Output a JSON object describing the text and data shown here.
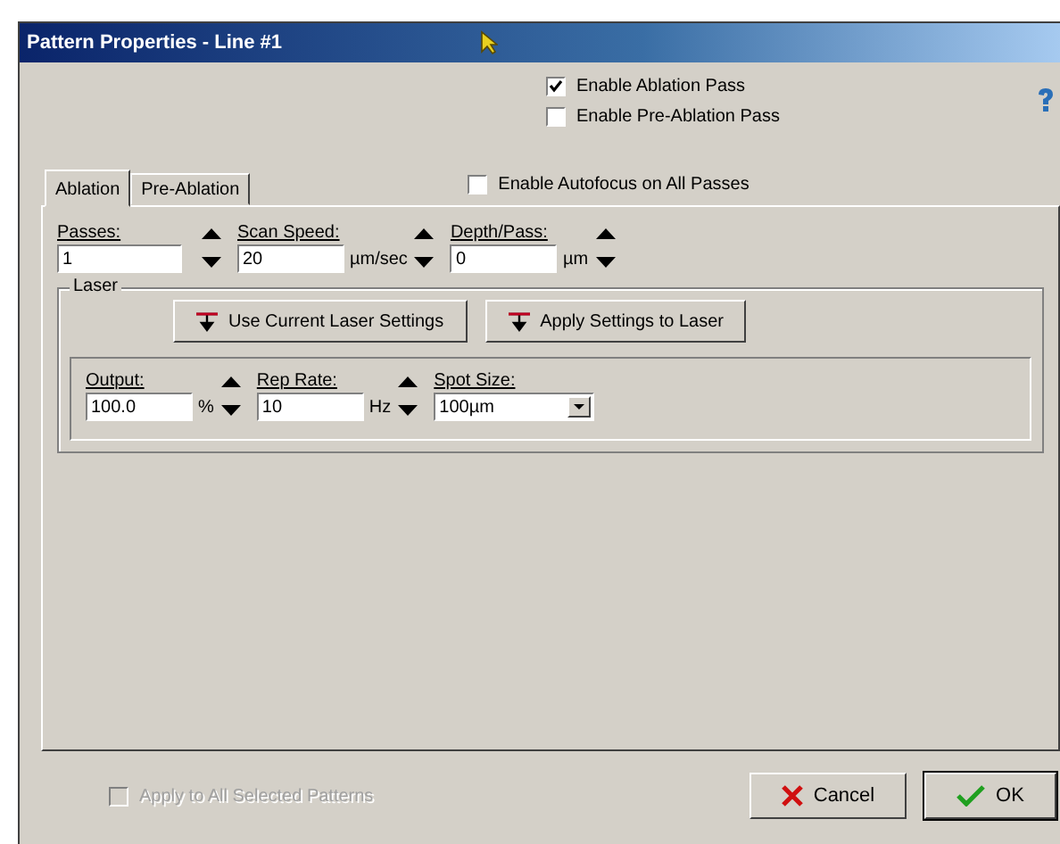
{
  "window": {
    "title": "Pattern Properties - Line #1"
  },
  "pass_options": [
    {
      "label": "Enable Ablation Pass",
      "checked": true
    },
    {
      "label": "Enable Pre-Ablation Pass",
      "checked": false
    }
  ],
  "tabs": [
    {
      "label": "Ablation",
      "selected": true
    },
    {
      "label": "Pre-Ablation",
      "selected": false
    }
  ],
  "autofocus": {
    "label": "Enable Autofocus on All Passes",
    "checked": false
  },
  "pass_fields": [
    {
      "label": "Passes:",
      "value": "1"
    },
    {
      "label": "Scan Speed:",
      "value": "20",
      "unit": "µm/sec"
    },
    {
      "label": "Depth/Pass:",
      "value": "0",
      "unit": "µm"
    }
  ],
  "laser": {
    "title": "Laser",
    "buttons": [
      "Use Current Laser Settings",
      "Apply Settings to Laser"
    ],
    "fields": [
      {
        "kind": "spin",
        "label": "Output:",
        "value": "100.0",
        "unit": "%"
      },
      {
        "kind": "spin",
        "label": "Rep Rate:",
        "value": "10",
        "unit": "Hz"
      },
      {
        "kind": "dropdown",
        "label": "Spot Size:",
        "value": "100µm"
      }
    ]
  },
  "apply_all": {
    "label": "Apply to All Selected Patterns",
    "checked": false,
    "disabled": true
  },
  "buttons": [
    {
      "kind": "cancel",
      "label": "Cancel",
      "default": false
    },
    {
      "kind": "ok",
      "label": "OK",
      "default": true
    }
  ]
}
